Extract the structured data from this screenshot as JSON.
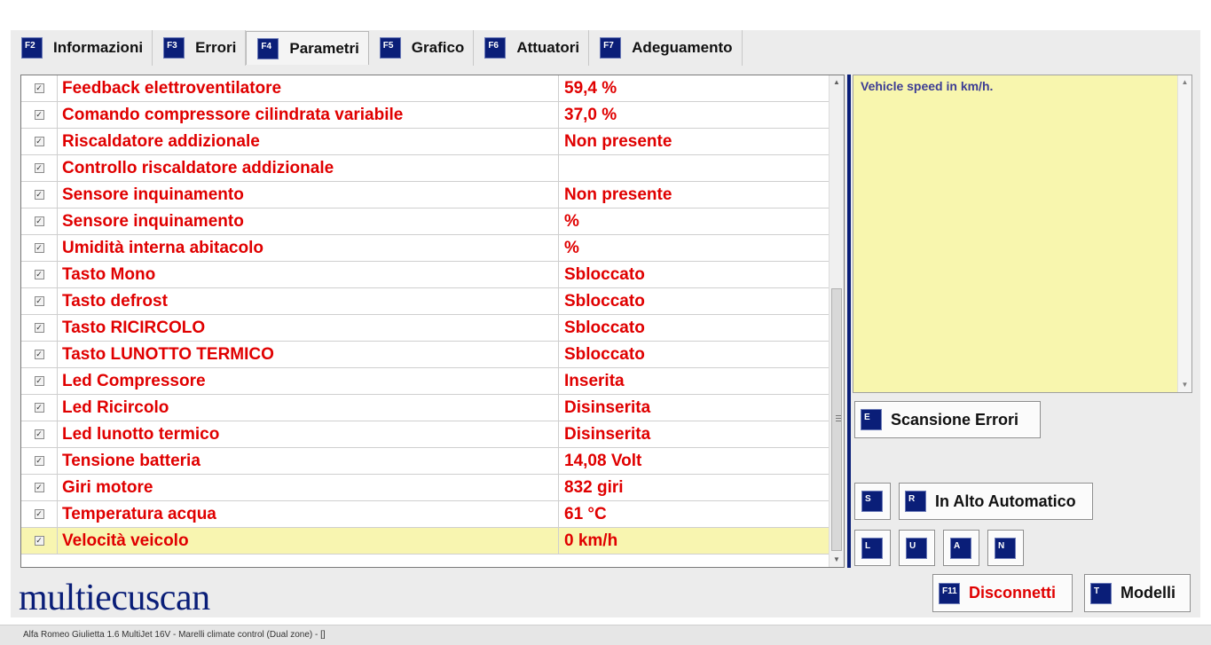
{
  "tabs": [
    {
      "key": "F2",
      "label": "Informazioni",
      "active": false
    },
    {
      "key": "F3",
      "label": "Errori",
      "active": false
    },
    {
      "key": "F4",
      "label": "Parametri",
      "active": true
    },
    {
      "key": "F5",
      "label": "Grafico",
      "active": false
    },
    {
      "key": "F6",
      "label": "Attuatori",
      "active": false
    },
    {
      "key": "F7",
      "label": "Adeguamento",
      "active": false
    }
  ],
  "parameters": [
    {
      "name": "Feedback elettroventilatore",
      "value": "59,4 %",
      "checked": true,
      "selected": false
    },
    {
      "name": "Comando compressore cilindrata variabile",
      "value": "37,0 %",
      "checked": true,
      "selected": false
    },
    {
      "name": "Riscaldatore addizionale",
      "value": "Non presente",
      "checked": true,
      "selected": false
    },
    {
      "name": "Controllo riscaldatore addizionale",
      "value": "",
      "checked": true,
      "selected": false
    },
    {
      "name": "Sensore inquinamento",
      "value": "Non presente",
      "checked": true,
      "selected": false
    },
    {
      "name": "Sensore inquinamento",
      "value": " %",
      "checked": true,
      "selected": false
    },
    {
      "name": "Umidità interna abitacolo",
      "value": " %",
      "checked": true,
      "selected": false
    },
    {
      "name": "Tasto Mono",
      "value": "Sbloccato",
      "checked": true,
      "selected": false
    },
    {
      "name": "Tasto defrost",
      "value": "Sbloccato",
      "checked": true,
      "selected": false
    },
    {
      "name": "Tasto RICIRCOLO",
      "value": "Sbloccato",
      "checked": true,
      "selected": false
    },
    {
      "name": "Tasto LUNOTTO TERMICO",
      "value": "Sbloccato",
      "checked": true,
      "selected": false
    },
    {
      "name": "Led Compressore",
      "value": "Inserita",
      "checked": true,
      "selected": false
    },
    {
      "name": "Led Ricircolo",
      "value": "Disinserita",
      "checked": true,
      "selected": false
    },
    {
      "name": "Led lunotto termico",
      "value": "Disinserita",
      "checked": true,
      "selected": false
    },
    {
      "name": "Tensione batteria",
      "value": "14,08 Volt",
      "checked": true,
      "selected": false
    },
    {
      "name": "Giri motore",
      "value": "832 giri",
      "checked": true,
      "selected": false
    },
    {
      "name": "Temperatura acqua",
      "value": "61 °C",
      "checked": true,
      "selected": false
    },
    {
      "name": "Velocità veicolo",
      "value": "0 km/h",
      "checked": true,
      "selected": true
    }
  ],
  "description": {
    "text": "Vehicle speed in km/h."
  },
  "buttons": {
    "scan_errors": {
      "key": "E",
      "label": "Scansione Errori"
    },
    "s": {
      "key": "S"
    },
    "auto_top": {
      "key": "R",
      "label": "In Alto Automatico"
    },
    "l": {
      "key": "L"
    },
    "u": {
      "key": "U"
    },
    "a": {
      "key": "A"
    },
    "n": {
      "key": "N"
    },
    "disconnect": {
      "key": "F11",
      "label": "Disconnetti"
    },
    "models": {
      "key": "T",
      "label": "Modelli"
    }
  },
  "logo": {
    "text": "multiecuscan"
  },
  "status": {
    "text": "Alfa Romeo Giulietta 1.6 MultiJet 16V - Marelli climate control (Dual zone) - []"
  },
  "colors": {
    "accent": "#0a1e78",
    "value_red": "#e00000",
    "highlight": "#f8f5b0",
    "desc_bg": "#f8f6ae"
  }
}
